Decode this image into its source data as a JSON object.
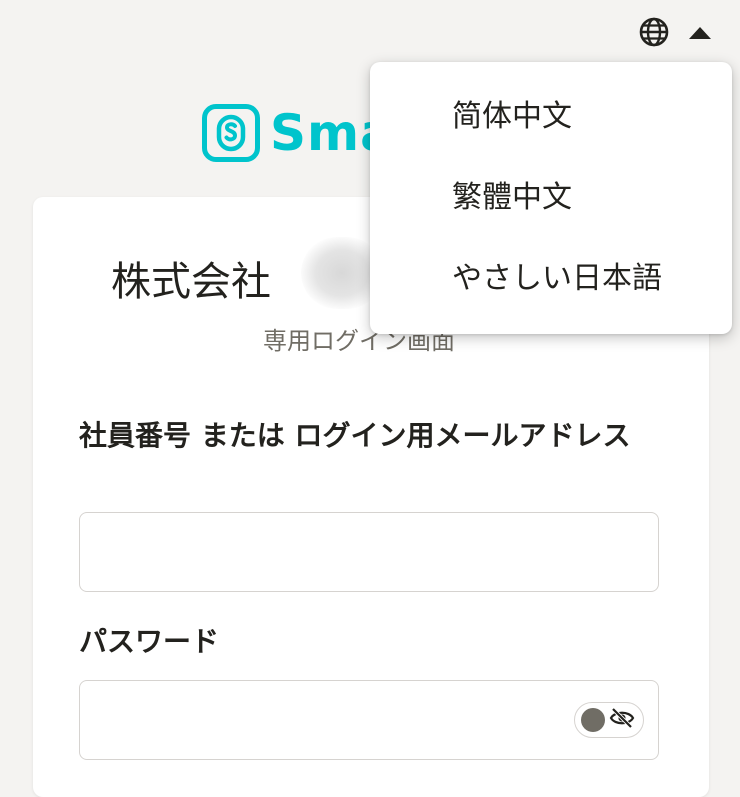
{
  "header": {
    "language_icon": "globe-icon",
    "menu_toggle_icon": "caret-up-icon"
  },
  "logo": {
    "text": "Sma",
    "icon": "smarthr-logo-icon",
    "brand_color": "#00c4cc"
  },
  "card": {
    "company_name": "株式会社",
    "subtitle": "専用ログイン画面",
    "email_label": "社員番号 または ログイン用メールアドレス",
    "email_value": "",
    "password_label": "パスワード",
    "password_value": "",
    "password_toggle_icon": "eye-slash-icon"
  },
  "language_menu": {
    "items": [
      {
        "label": "简体中文"
      },
      {
        "label": "繁體中文"
      },
      {
        "label": "やさしい日本語"
      }
    ]
  },
  "colors": {
    "background": "#f4f3f1",
    "card": "#ffffff",
    "text_primary": "#23221e",
    "text_secondary": "#706d65",
    "border": "#d6d3d0"
  }
}
